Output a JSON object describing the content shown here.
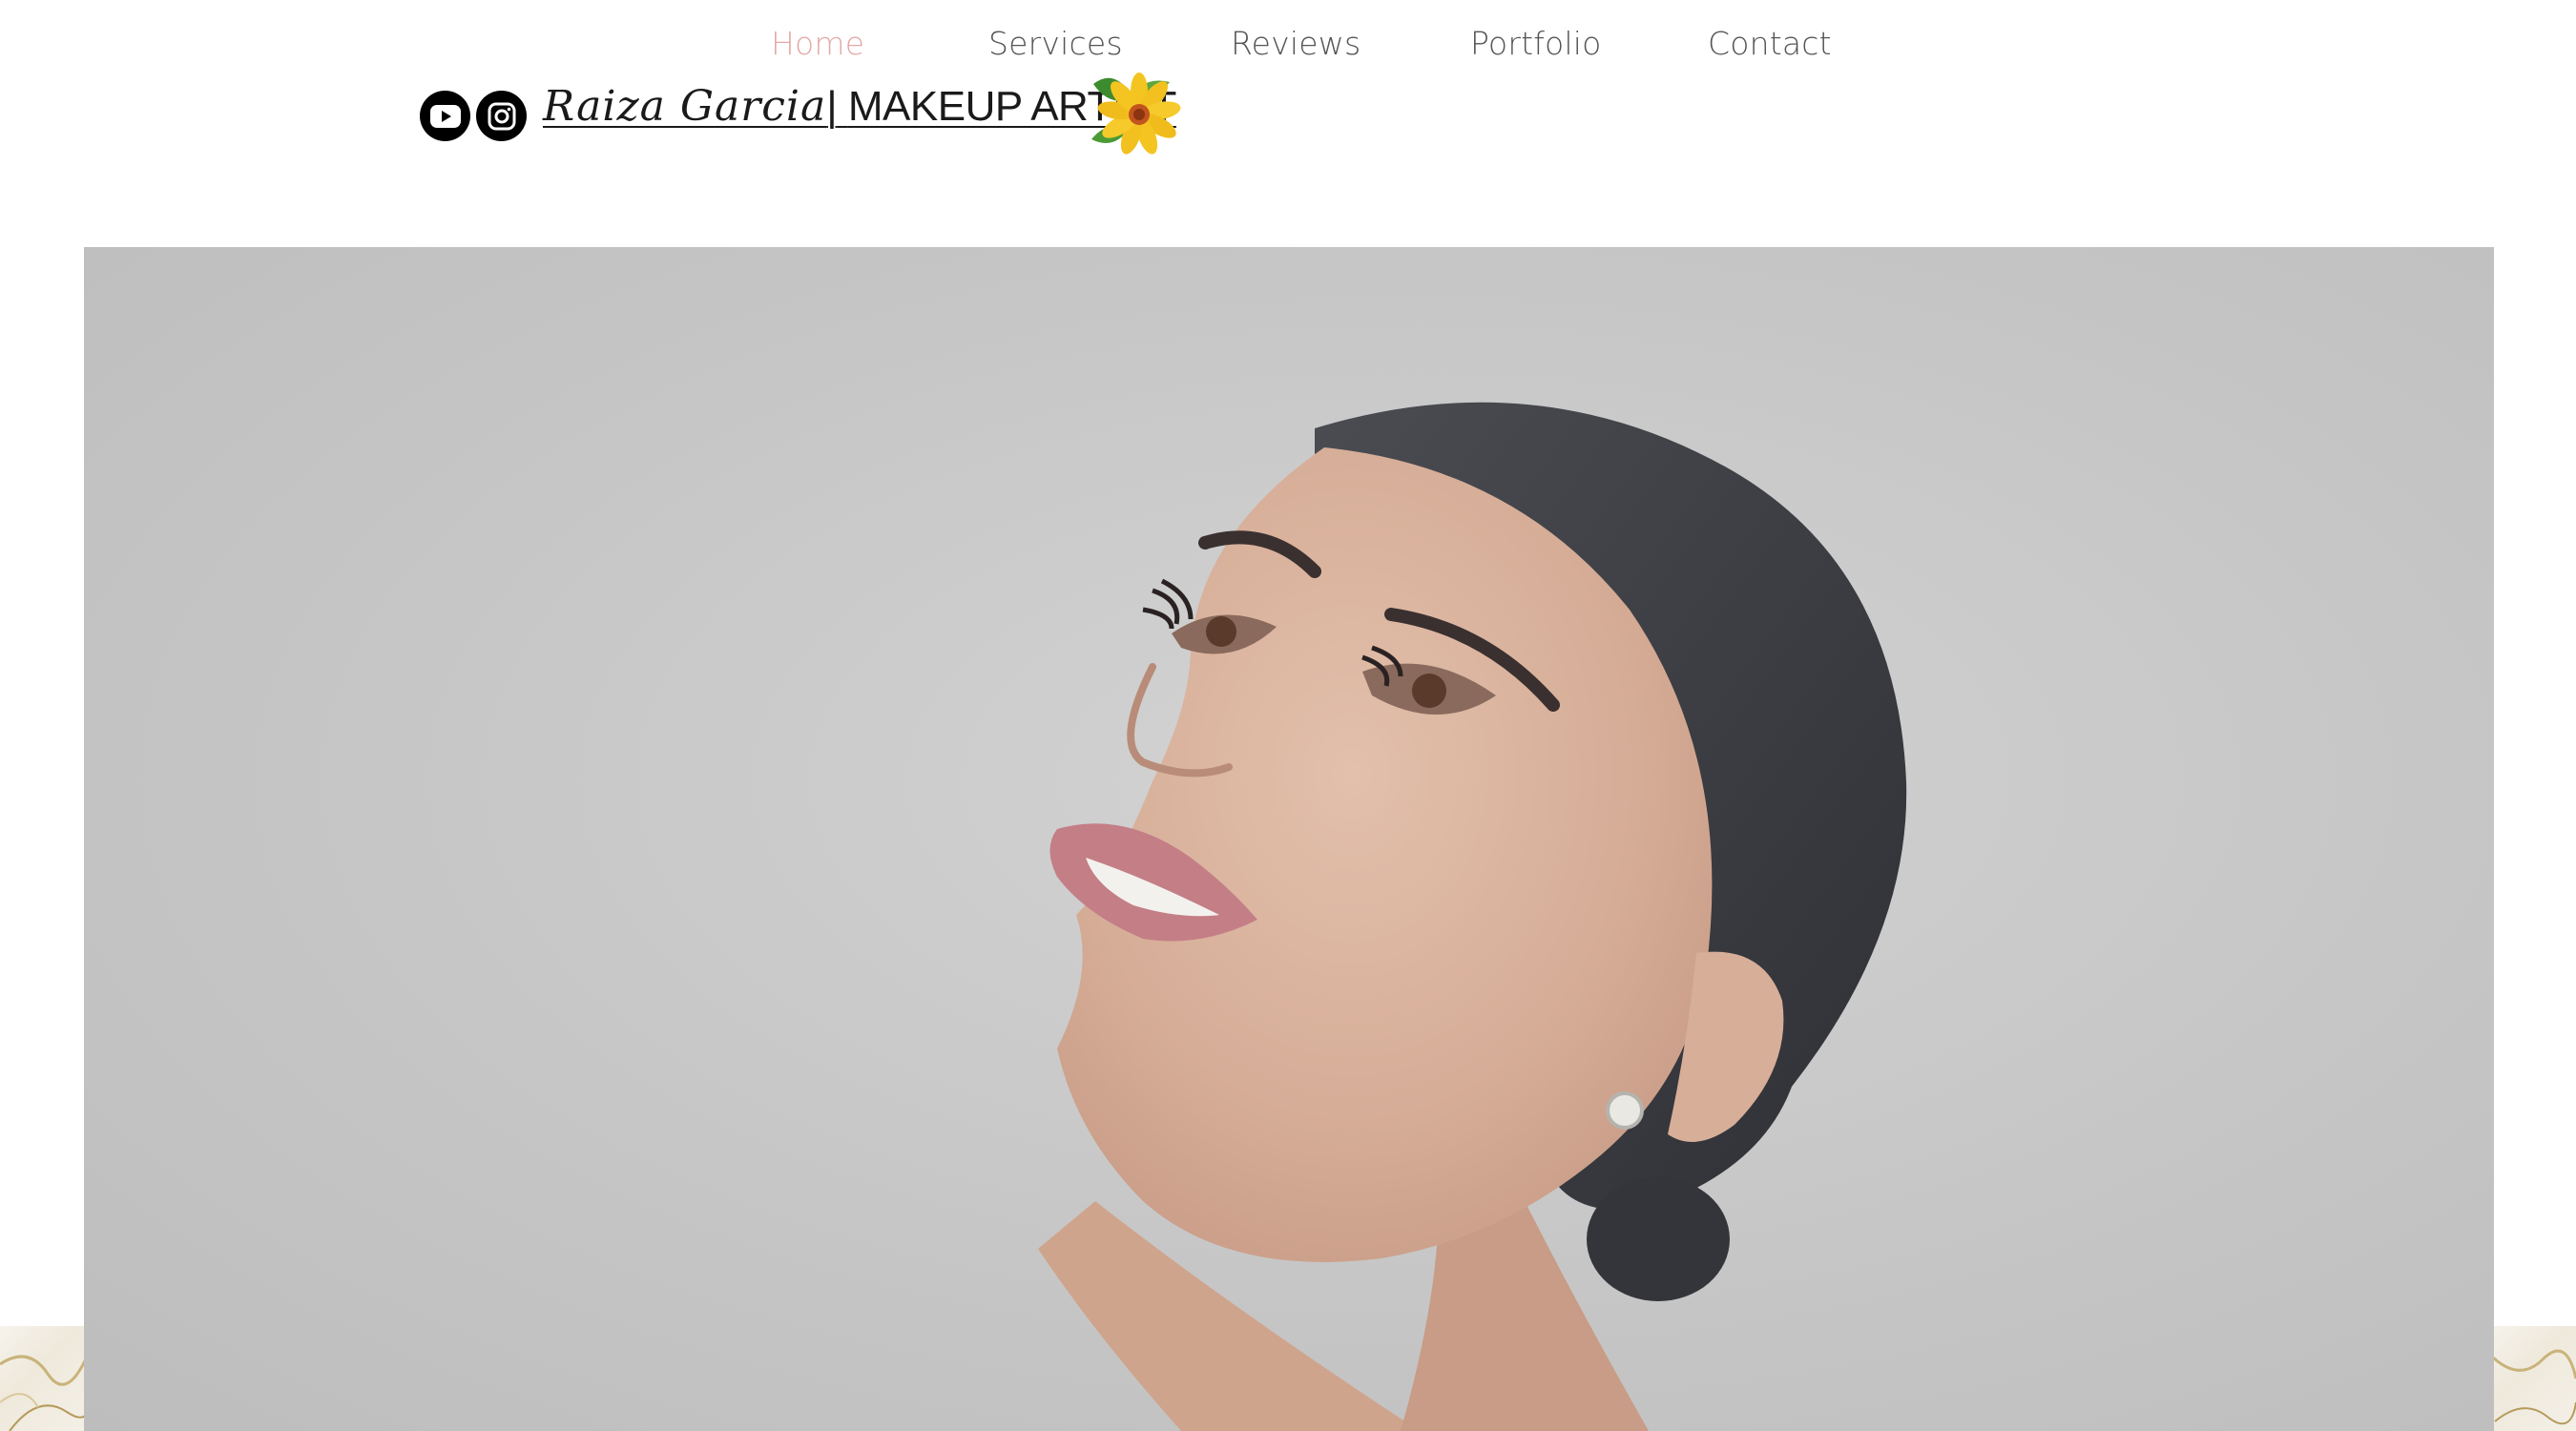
{
  "nav": {
    "items": [
      {
        "label": "Home",
        "active": true
      },
      {
        "label": "Services",
        "active": false
      },
      {
        "label": "Reviews",
        "active": false
      },
      {
        "label": "Portfolio",
        "active": false
      },
      {
        "label": "Contact",
        "active": false
      }
    ]
  },
  "header": {
    "brand_name": "Raiza Garcia",
    "brand_separator": "|",
    "brand_title": "MAKEUP ARTIST",
    "social": [
      {
        "name": "YouTube",
        "icon": "youtube-icon"
      },
      {
        "name": "Instagram",
        "icon": "instagram-icon"
      }
    ],
    "logo_icon": "yellow-flower-icon"
  },
  "hero": {
    "image": "portrait-woman-makeup"
  },
  "colors": {
    "nav_text": "#555555",
    "nav_active": "#e4a9a7",
    "brand_text": "#1a1a1a",
    "hero_background": "#c8c8c8"
  }
}
